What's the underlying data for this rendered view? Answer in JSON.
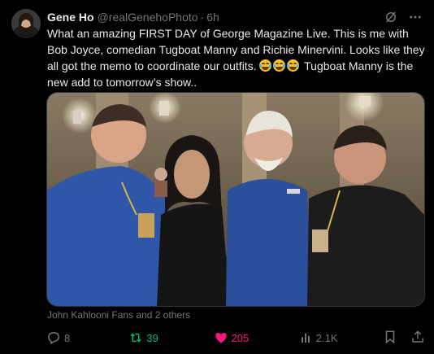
{
  "tweet": {
    "author_name": "Gene Ho",
    "handle": "@realGenehoPhoto",
    "separator": "·",
    "time": "6h",
    "text_main": "What an amazing FIRST DAY of George Magazine Live. This is me with Bob Joyce, comedian Tugboat Manny and Richie Minervini. Looks like they all got the memo to coordinate our outfits.",
    "emojis": [
      "face-with-tears-of-joy",
      "face-with-tears-of-joy",
      "face-with-tears-of-joy"
    ],
    "text_after": "Tugboat Manny is the new add to tomorrow’s show..",
    "tagged_line": "John Kahlooni Fans and 2 others"
  },
  "actions": {
    "replies": "8",
    "reposts": "39",
    "likes": "205",
    "views": "2.1K"
  },
  "colors": {
    "background": "#000000",
    "text": "#e7e9ea",
    "muted": "#71767b",
    "repost_active": "#00ba7c",
    "like_active": "#f91880"
  },
  "icons": {
    "header": [
      "grok-icon",
      "more-icon"
    ],
    "actions": [
      "reply-icon",
      "repost-icon",
      "heart-icon",
      "views-icon",
      "bookmark-icon",
      "share-icon"
    ]
  }
}
